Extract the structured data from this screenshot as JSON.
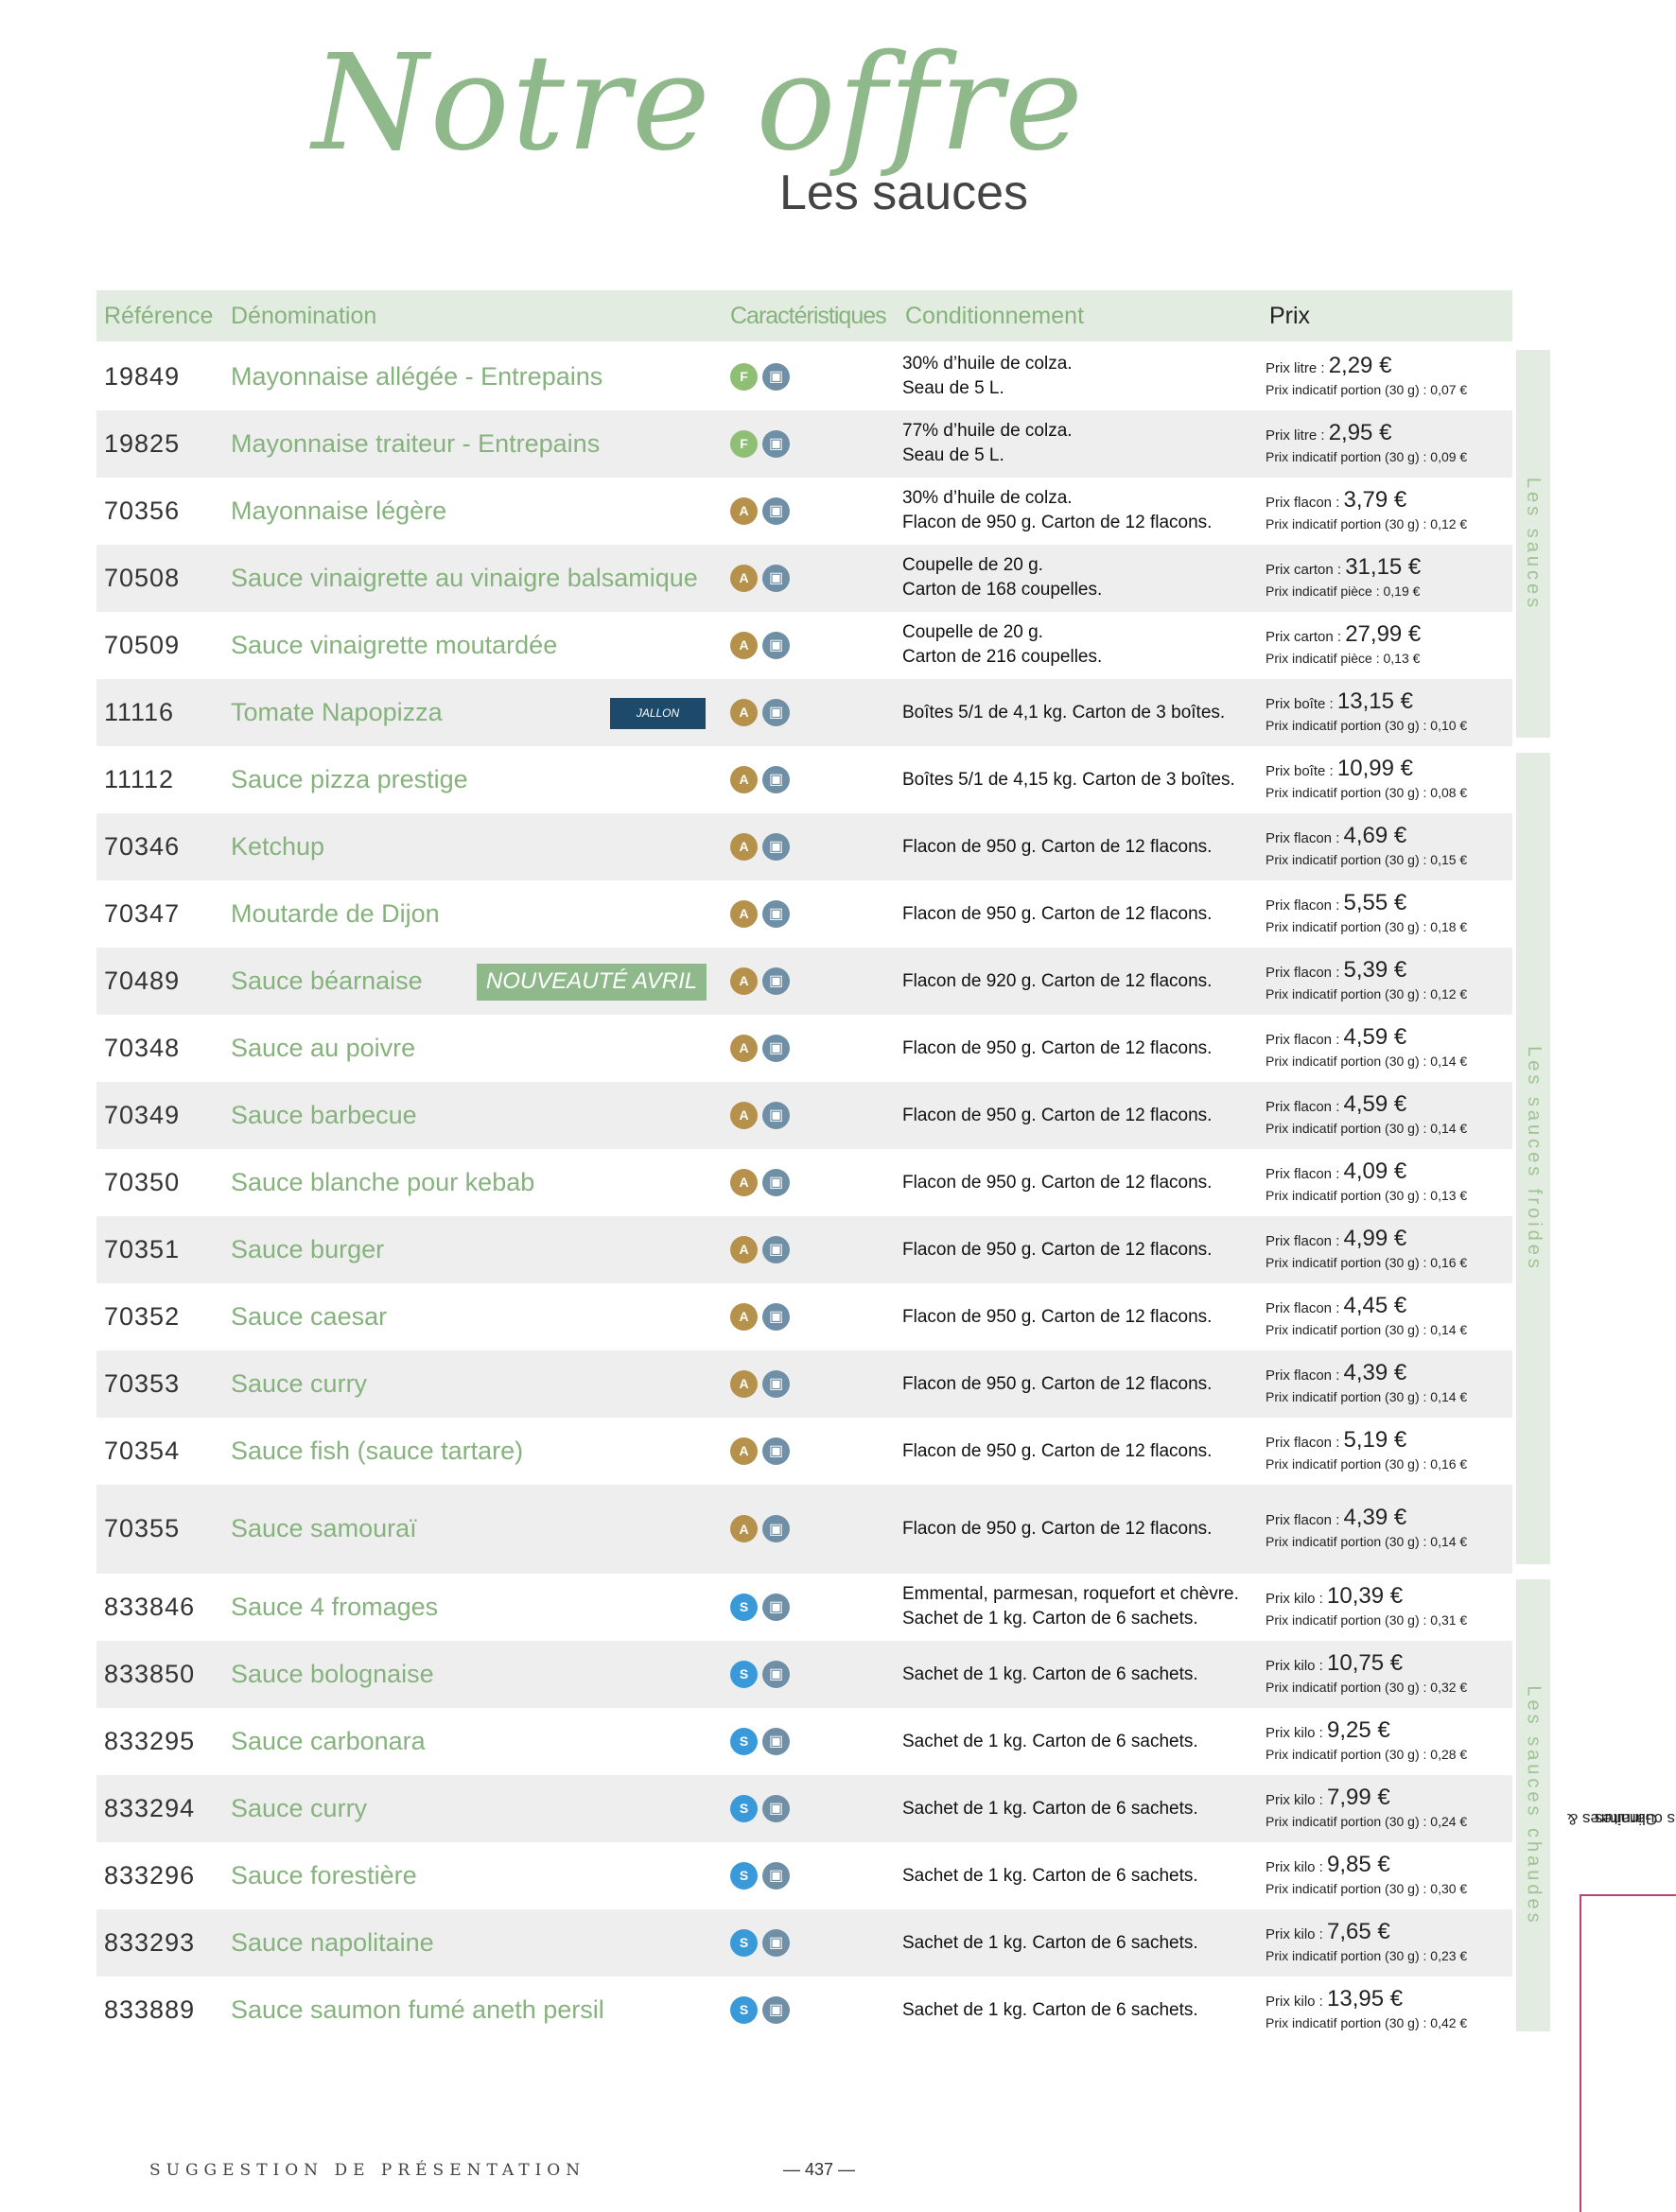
{
  "page": {
    "title": "Notre offre",
    "subtitle": "Les sauces"
  },
  "header": {
    "reference": "Référence",
    "denomination": "Dénomination",
    "caracteristiques": "Caractéristiques",
    "conditionnement": "Conditionnement",
    "prix": "Prix"
  },
  "rows": [
    {
      "ref": "19849",
      "name": "Mayonnaise allégée - Entrepains",
      "badge": "F",
      "cond1": "30% d’huile de colza.",
      "cond2": "Seau de 5 L.",
      "prix_label": "Prix litre : ",
      "prix_value": "2,29 €",
      "prix_portion": "Prix indicatif portion (30 g) : 0,07 €"
    },
    {
      "ref": "19825",
      "name": "Mayonnaise traiteur - Entrepains",
      "badge": "F",
      "cond1": "77% d’huile de colza.",
      "cond2": "Seau de 5 L.",
      "prix_label": "Prix litre : ",
      "prix_value": "2,95 €",
      "prix_portion": "Prix indicatif portion (30 g) : 0,09 €"
    },
    {
      "ref": "70356",
      "name": "Mayonnaise légère",
      "badge": "A",
      "cond1": "30% d’huile de colza.",
      "cond2": "Flacon de 950 g. Carton de 12 flacons.",
      "prix_label": "Prix flacon : ",
      "prix_value": "3,79 €",
      "prix_portion": "Prix indicatif portion (30 g) : 0,12 €"
    },
    {
      "ref": "70508",
      "name": "Sauce vinaigrette au vinaigre balsamique",
      "badge": "A",
      "cond1": "Coupelle de 20 g.",
      "cond2": "Carton de 168 coupelles.",
      "prix_label": "Prix carton : ",
      "prix_value": "31,15 €",
      "prix_portion": "Prix indicatif pièce : 0,19 €"
    },
    {
      "ref": "70509",
      "name": "Sauce vinaigrette moutardée",
      "badge": "A",
      "cond1": "Coupelle de 20 g.",
      "cond2": "Carton de 216 coupelles.",
      "prix_label": "Prix carton : ",
      "prix_value": "27,99 €",
      "prix_portion": "Prix indicatif pièce : 0,13 €"
    },
    {
      "ref": "11116",
      "name": "Tomate Napopizza",
      "badge": "A",
      "tag": "JALLON",
      "cond1": "Boîtes 5/1 de 4,1 kg. Carton de 3 boîtes.",
      "cond2": "",
      "prix_label": "Prix boîte : ",
      "prix_value": "13,15 €",
      "prix_portion": "Prix indicatif portion (30 g) : 0,10 €"
    },
    {
      "ref": "11112",
      "name": "Sauce pizza prestige",
      "badge": "A",
      "cond1": "Boîtes 5/1 de 4,15 kg. Carton de 3 boîtes.",
      "cond2": "",
      "prix_label": "Prix boîte : ",
      "prix_value": "10,99 €",
      "prix_portion": "Prix indicatif portion (30 g) : 0,08 €"
    },
    {
      "ref": "70346",
      "name": "Ketchup",
      "badge": "A",
      "cond1": "Flacon de 950 g. Carton de 12 flacons.",
      "cond2": "",
      "prix_label": "Prix flacon : ",
      "prix_value": "4,69 €",
      "prix_portion": "Prix indicatif portion (30 g) : 0,15 €"
    },
    {
      "ref": "70347",
      "name": "Moutarde de Dijon",
      "badge": "A",
      "cond1": "Flacon de 950 g. Carton de 12 flacons.",
      "cond2": "",
      "prix_label": "Prix flacon : ",
      "prix_value": "5,55 €",
      "prix_portion": "Prix indicatif portion (30 g) : 0,18 €"
    },
    {
      "ref": "70489",
      "name": "Sauce béarnaise",
      "badge": "A",
      "new": "NOUVEAUTÉ AVRIL",
      "cond1": "Flacon de 920 g. Carton de 12 flacons.",
      "cond2": "",
      "prix_label": "Prix flacon : ",
      "prix_value": "5,39 €",
      "prix_portion": "Prix indicatif portion (30 g) : 0,12 €"
    },
    {
      "ref": "70348",
      "name": "Sauce au poivre",
      "badge": "A",
      "cond1": "Flacon de 950 g. Carton de 12 flacons.",
      "cond2": "",
      "prix_label": "Prix flacon : ",
      "prix_value": "4,59 €",
      "prix_portion": "Prix indicatif portion (30 g) : 0,14 €"
    },
    {
      "ref": "70349",
      "name": "Sauce barbecue",
      "badge": "A",
      "cond1": "Flacon de 950 g. Carton de 12 flacons.",
      "cond2": "",
      "prix_label": "Prix flacon : ",
      "prix_value": "4,59 €",
      "prix_portion": "Prix indicatif portion (30 g) : 0,14 €"
    },
    {
      "ref": "70350",
      "name": "Sauce blanche pour kebab",
      "badge": "A",
      "cond1": "Flacon de 950 g. Carton de 12 flacons.",
      "cond2": "",
      "prix_label": "Prix flacon : ",
      "prix_value": "4,09 €",
      "prix_portion": "Prix indicatif portion (30 g) : 0,13 €"
    },
    {
      "ref": "70351",
      "name": "Sauce burger",
      "badge": "A",
      "cond1": "Flacon de 950 g. Carton de 12 flacons.",
      "cond2": "",
      "prix_label": "Prix flacon : ",
      "prix_value": "4,99 €",
      "prix_portion": "Prix indicatif portion (30 g) : 0,16 €"
    },
    {
      "ref": "70352",
      "name": "Sauce caesar",
      "badge": "A",
      "cond1": "Flacon de 950 g. Carton de 12 flacons.",
      "cond2": "",
      "prix_label": "Prix flacon : ",
      "prix_value": "4,45 €",
      "prix_portion": "Prix indicatif portion (30 g) : 0,14 €"
    },
    {
      "ref": "70353",
      "name": "Sauce curry",
      "badge": "A",
      "cond1": "Flacon de 950 g. Carton de 12 flacons.",
      "cond2": "",
      "prix_label": "Prix flacon : ",
      "prix_value": "4,39 €",
      "prix_portion": "Prix indicatif portion (30 g) : 0,14 €"
    },
    {
      "ref": "70354",
      "name": "Sauce fish (sauce tartare)",
      "badge": "A",
      "cond1": "Flacon de 950 g. Carton de 12 flacons.",
      "cond2": "",
      "prix_label": "Prix flacon : ",
      "prix_value": "5,19 €",
      "prix_portion": "Prix indicatif portion (30 g) : 0,16 €"
    },
    {
      "ref": "70355",
      "name": "Sauce samouraï",
      "badge": "A",
      "cond1": "Flacon de 950 g. Carton de 12 flacons.",
      "cond2": "",
      "prix_label": "Prix flacon : ",
      "prix_value": "4,39 €",
      "prix_portion": "Prix indicatif portion (30 g) : 0,14 €"
    },
    {
      "ref": "833846",
      "name": "Sauce 4 fromages",
      "badge": "S",
      "cond1": "Emmental, parmesan, roquefort et chèvre.",
      "cond2": "Sachet de 1 kg. Carton de 6 sachets.",
      "prix_label": "Prix kilo : ",
      "prix_value": "10,39 €",
      "prix_portion": "Prix indicatif portion (30 g) : 0,31 €"
    },
    {
      "ref": "833850",
      "name": "Sauce bolognaise",
      "badge": "S",
      "cond1": "Sachet de 1 kg. Carton de 6 sachets.",
      "cond2": "",
      "prix_label": "Prix kilo : ",
      "prix_value": "10,75 €",
      "prix_portion": "Prix indicatif portion (30 g) : 0,32 €"
    },
    {
      "ref": "833295",
      "name": "Sauce carbonara",
      "badge": "S",
      "cond1": "Sachet de 1 kg. Carton de 6 sachets.",
      "cond2": "",
      "prix_label": "Prix kilo : ",
      "prix_value": "9,25 €",
      "prix_portion": "Prix indicatif portion (30 g) : 0,28 €"
    },
    {
      "ref": "833294",
      "name": "Sauce curry",
      "badge": "S",
      "cond1": "Sachet de 1 kg. Carton de 6 sachets.",
      "cond2": "",
      "prix_label": "Prix kilo : ",
      "prix_value": "7,99 €",
      "prix_portion": "Prix indicatif portion (30 g) : 0,24 €"
    },
    {
      "ref": "833296",
      "name": "Sauce forestière",
      "badge": "S",
      "cond1": "Sachet de 1 kg. Carton de 6 sachets.",
      "cond2": "",
      "prix_label": "Prix kilo : ",
      "prix_value": "9,85 €",
      "prix_portion": "Prix indicatif portion (30 g) : 0,30 €"
    },
    {
      "ref": "833293",
      "name": "Sauce napolitaine",
      "badge": "S",
      "cond1": "Sachet de 1 kg. Carton de 6 sachets.",
      "cond2": "",
      "prix_label": "Prix kilo : ",
      "prix_value": "7,65 €",
      "prix_portion": "Prix indicatif portion (30 g) : 0,23 €"
    },
    {
      "ref": "833889",
      "name": "Sauce saumon fumé aneth persil",
      "badge": "S",
      "cond1": "Sachet de 1 kg. Carton de 6 sachets.",
      "cond2": "",
      "prix_label": "Prix kilo : ",
      "prix_value": "13,95 €",
      "prix_portion": "Prix indicatif portion (30 g) : 0,42 €"
    }
  ],
  "sections": {
    "sauces": "Les sauces",
    "froides": "Les sauces froides",
    "chaudes": "Les sauces chaudes"
  },
  "chapter": {
    "line1": "Garnitures &",
    "line2": "aides culinaires"
  },
  "footer": {
    "suggestion": "SUGGESTION DE PRÉSENTATION",
    "page": "— 437 —"
  },
  "colors": {
    "accent_green": "#86b27d",
    "header_bg": "#e3ece1",
    "row_alt": "#eeeeee",
    "jallon_blue": "#1d4a6b",
    "pink_rule": "#b6427a"
  },
  "icons": {
    "badge_F": "F",
    "badge_A": "A",
    "badge_S": "S",
    "pack": "carton-icon"
  }
}
